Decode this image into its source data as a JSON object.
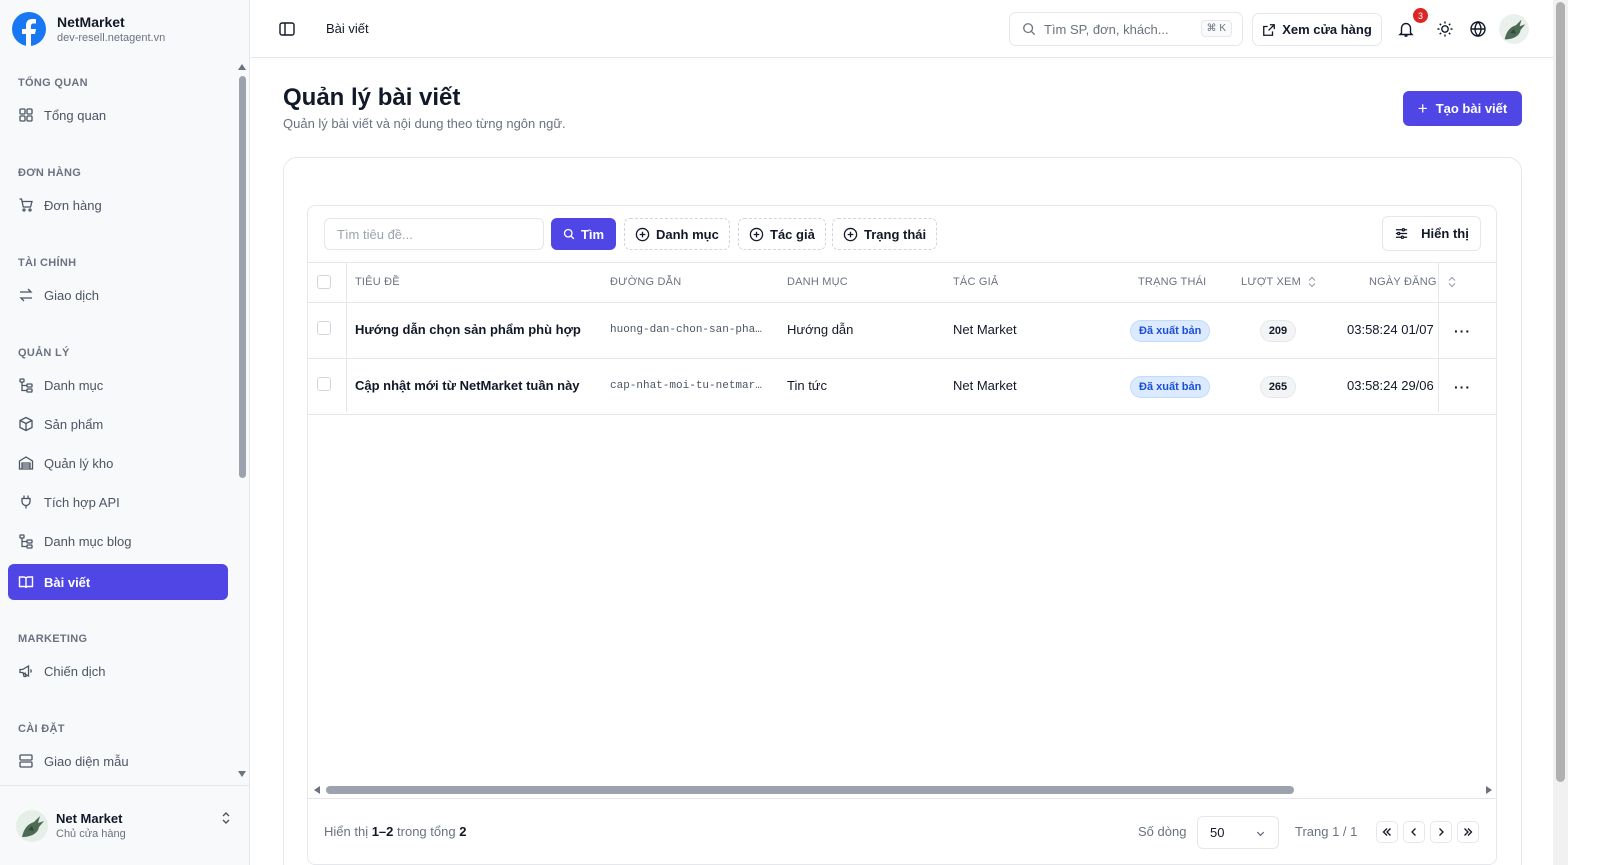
{
  "brand": {
    "name": "NetMarket",
    "domain": "dev-resell.netagent.vn"
  },
  "sidebar": {
    "groups": [
      {
        "title": "TỔNG QUAN",
        "items": [
          {
            "label": "Tổng quan",
            "icon": "dashboard-grid-icon"
          }
        ]
      },
      {
        "title": "ĐƠN HÀNG",
        "items": [
          {
            "label": "Đơn hàng",
            "icon": "cart-icon"
          }
        ]
      },
      {
        "title": "TÀI CHÍNH",
        "items": [
          {
            "label": "Giao dịch",
            "icon": "transfer-arrows-icon"
          }
        ]
      },
      {
        "title": "QUẢN LÝ",
        "items": [
          {
            "label": "Danh mục",
            "icon": "tree-icon"
          },
          {
            "label": "Sản phẩm",
            "icon": "box-icon"
          },
          {
            "label": "Quản lý kho",
            "icon": "warehouse-icon"
          },
          {
            "label": "Tích hợp API",
            "icon": "plug-icon"
          },
          {
            "label": "Danh mục blog",
            "icon": "tree-icon"
          },
          {
            "label": "Bài viết",
            "icon": "book-icon",
            "active": true
          }
        ]
      },
      {
        "title": "MARKETING",
        "items": [
          {
            "label": "Chiến dịch",
            "icon": "megaphone-icon"
          }
        ]
      },
      {
        "title": "CÀI ĐẶT",
        "items": [
          {
            "label": "Giao diện mẫu",
            "icon": "layout-icon"
          }
        ]
      }
    ],
    "user": {
      "name": "Net Market",
      "role": "Chủ cửa hàng"
    }
  },
  "header": {
    "breadcrumb": "Bài viết",
    "search_placeholder": "Tìm SP, đơn, khách...",
    "search_shortcut": "⌘ K",
    "store_button": "Xem cửa hàng",
    "notification_count": "3"
  },
  "page": {
    "title": "Quản lý bài viết",
    "subtitle": "Quản lý bài viết và nội dung theo từng ngôn ngữ.",
    "create_button": "Tạo bài viết"
  },
  "toolbar": {
    "search_placeholder": "Tìm tiêu đề...",
    "search_button": "Tìm",
    "filters": [
      "Danh mục",
      "Tác giả",
      "Trạng thái"
    ],
    "view_button": "Hiển thị"
  },
  "table": {
    "columns": [
      "TIÊU ĐỀ",
      "ĐƯỜNG DẪN",
      "DANH MỤC",
      "TÁC GIẢ",
      "TRẠNG THÁI",
      "LƯỢT XEM",
      "NGÀY ĐĂNG"
    ],
    "rows": [
      {
        "title": "Hướng dẫn chọn sản phẩm phù hợp",
        "slug": "huong-dan-chon-san-pham…",
        "category": "Hướng dẫn",
        "author": "Net Market",
        "status": "Đã xuất bản",
        "views": "209",
        "date": "03:58:24 01/07"
      },
      {
        "title": "Cập nhật mới từ NetMarket tuần này",
        "slug": "cap-nhat-moi-tu-netmark…",
        "category": "Tin tức",
        "author": "Net Market",
        "status": "Đã xuất bản",
        "views": "265",
        "date": "03:58:24 29/06"
      }
    ]
  },
  "footer": {
    "showing_prefix": "Hiển thị",
    "range": "1–2",
    "total_prefix": "trong tổng",
    "total": "2",
    "rows_label": "Số dòng",
    "rows_value": "50",
    "page_label": "Trang 1 / 1"
  },
  "colors": {
    "accent": "#4f46e5",
    "badge_bg": "#dbeafe",
    "badge_text": "#1d4ed8",
    "notification": "#dc2626",
    "brand_logo": "#1877f2"
  }
}
